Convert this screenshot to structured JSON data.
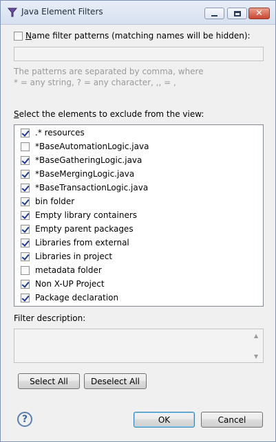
{
  "window": {
    "title": "Java Element Filters"
  },
  "name_filter": {
    "checkbox_checked": false,
    "label": "Name filter patterns (matching names will be hidden):",
    "input_value": "",
    "hint_line1": "The patterns are separated by comma, where",
    "hint_line2": "* = any string, ? = any character, ,, = ,"
  },
  "elements": {
    "label": "Select the elements to exclude from the view:",
    "items": [
      {
        "label": ".* resources",
        "checked": true
      },
      {
        "label": "*BaseAutomationLogic.java",
        "checked": false
      },
      {
        "label": "*BaseGatheringLogic.java",
        "checked": true
      },
      {
        "label": "*BaseMergingLogic.java",
        "checked": true
      },
      {
        "label": "*BaseTransactionLogic.java",
        "checked": true
      },
      {
        "label": "bin folder",
        "checked": true
      },
      {
        "label": "Empty library containers",
        "checked": true
      },
      {
        "label": "Empty parent packages",
        "checked": true
      },
      {
        "label": "Libraries from external",
        "checked": true
      },
      {
        "label": "Libraries in project",
        "checked": true
      },
      {
        "label": "metadata folder",
        "checked": false
      },
      {
        "label": "Non X-UP Project",
        "checked": true
      },
      {
        "label": "Package declaration",
        "checked": true
      }
    ]
  },
  "description": {
    "label": "Filter description:",
    "value": ""
  },
  "buttons": {
    "select_all": "Select All",
    "deselect_all": "Deselect All",
    "ok": "OK",
    "cancel": "Cancel"
  },
  "icons": {
    "app": "eclipse-filter-icon",
    "help": "help-icon",
    "help_glyph": "?",
    "minimize_glyph": "",
    "close_glyph": "✕",
    "scroll_up_glyph": "▲",
    "scroll_down_glyph": "▼"
  },
  "colors": {
    "accent": "#3c7fb1",
    "hint_text": "#9a9a9a",
    "checkmark": "#1b3a8b"
  }
}
